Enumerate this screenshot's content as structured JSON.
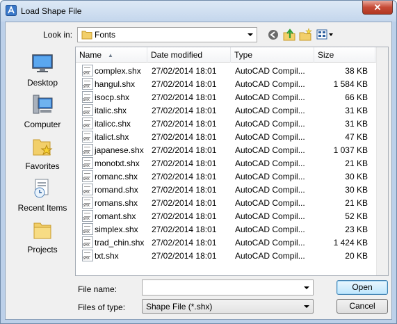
{
  "window": {
    "title": "Load Shape File",
    "close_glyph": "✕"
  },
  "toolbar": {
    "look_in_label": "Look in:",
    "look_in_value": "Fonts",
    "icons": [
      "back-icon",
      "up-folder-icon",
      "new-folder-icon",
      "view-menu-icon"
    ]
  },
  "places": [
    {
      "label": "Desktop",
      "icon": "desktop-icon"
    },
    {
      "label": "Computer",
      "icon": "computer-icon"
    },
    {
      "label": "Favorites",
      "icon": "favorites-icon"
    },
    {
      "label": "Recent Items",
      "icon": "recent-items-icon"
    },
    {
      "label": "Projects",
      "icon": "projects-folder-icon"
    }
  ],
  "columns": [
    "Name",
    "Date modified",
    "Type",
    "Size"
  ],
  "files": [
    {
      "name": "complex.shx",
      "date": "27/02/2014 18:01",
      "type": "AutoCAD Compil...",
      "size": "38 KB"
    },
    {
      "name": "hangul.shx",
      "date": "27/02/2014 18:01",
      "type": "AutoCAD Compil...",
      "size": "1 584 KB"
    },
    {
      "name": "isocp.shx",
      "date": "27/02/2014 18:01",
      "type": "AutoCAD Compil...",
      "size": "66 KB"
    },
    {
      "name": "italic.shx",
      "date": "27/02/2014 18:01",
      "type": "AutoCAD Compil...",
      "size": "31 KB"
    },
    {
      "name": "italicc.shx",
      "date": "27/02/2014 18:01",
      "type": "AutoCAD Compil...",
      "size": "31 KB"
    },
    {
      "name": "italict.shx",
      "date": "27/02/2014 18:01",
      "type": "AutoCAD Compil...",
      "size": "47 KB"
    },
    {
      "name": "japanese.shx",
      "date": "27/02/2014 18:01",
      "type": "AutoCAD Compil...",
      "size": "1 037 KB"
    },
    {
      "name": "monotxt.shx",
      "date": "27/02/2014 18:01",
      "type": "AutoCAD Compil...",
      "size": "21 KB"
    },
    {
      "name": "romanc.shx",
      "date": "27/02/2014 18:01",
      "type": "AutoCAD Compil...",
      "size": "30 KB"
    },
    {
      "name": "romand.shx",
      "date": "27/02/2014 18:01",
      "type": "AutoCAD Compil...",
      "size": "30 KB"
    },
    {
      "name": "romans.shx",
      "date": "27/02/2014 18:01",
      "type": "AutoCAD Compil...",
      "size": "21 KB"
    },
    {
      "name": "romant.shx",
      "date": "27/02/2014 18:01",
      "type": "AutoCAD Compil...",
      "size": "52 KB"
    },
    {
      "name": "simplex.shx",
      "date": "27/02/2014 18:01",
      "type": "AutoCAD Compil...",
      "size": "23 KB"
    },
    {
      "name": "trad_chin.shx",
      "date": "27/02/2014 18:01",
      "type": "AutoCAD Compil...",
      "size": "1 424 KB"
    },
    {
      "name": "txt.shx",
      "date": "27/02/2014 18:01",
      "type": "AutoCAD Compil...",
      "size": "20 KB"
    }
  ],
  "bottom": {
    "file_name_label": "File name:",
    "file_name_value": "",
    "files_of_type_label": "Files of type:",
    "files_of_type_value": "Shape File (*.shx)",
    "open_label": "Open",
    "cancel_label": "Cancel"
  },
  "colors": {
    "title_bar": "#c4d6ec",
    "close_button": "#c64a36",
    "dialog_bg": "#f0f0f0"
  }
}
